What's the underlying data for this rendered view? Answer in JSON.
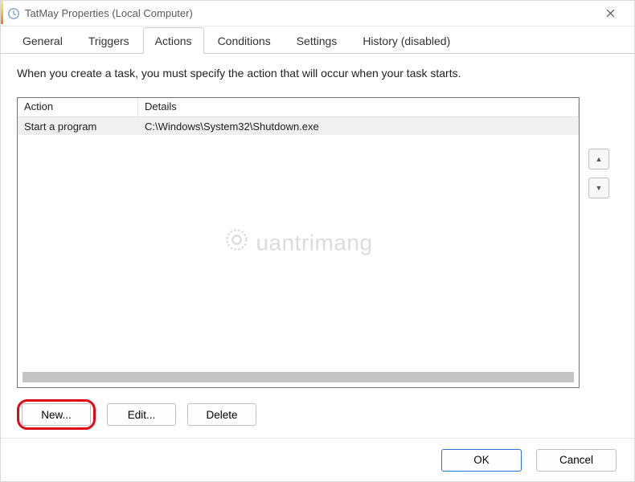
{
  "window": {
    "title": "TatMay Properties (Local Computer)"
  },
  "tabs": {
    "items": [
      {
        "label": "General"
      },
      {
        "label": "Triggers"
      },
      {
        "label": "Actions"
      },
      {
        "label": "Conditions"
      },
      {
        "label": "Settings"
      },
      {
        "label": "History (disabled)"
      }
    ],
    "active_index": 2
  },
  "main": {
    "instruction": "When you create a task, you must specify the action that will occur when your task starts.",
    "columns": {
      "action": "Action",
      "details": "Details"
    },
    "rows": [
      {
        "action": "Start a program",
        "details": "C:\\Windows\\System32\\Shutdown.exe"
      }
    ],
    "buttons": {
      "new": "New...",
      "edit": "Edit...",
      "delete": "Delete"
    }
  },
  "footer": {
    "ok": "OK",
    "cancel": "Cancel"
  },
  "watermark": {
    "text": "uantrimang"
  },
  "icons": {
    "app": "clock-icon",
    "close": "close-icon",
    "up": "chevron-up-icon",
    "down": "chevron-down-icon",
    "gear": "gear-icon"
  }
}
